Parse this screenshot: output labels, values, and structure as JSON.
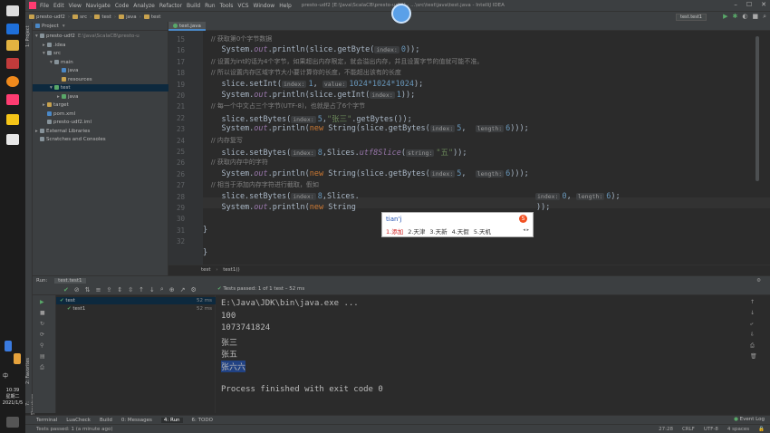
{
  "taskbar": {
    "time": "10:39",
    "weekday": "星期二",
    "date": "2021/1/5",
    "lang": "中"
  },
  "menu": [
    "File",
    "Edit",
    "View",
    "Navigate",
    "Code",
    "Analyze",
    "Refactor",
    "Build",
    "Run",
    "Tools",
    "VCS",
    "Window",
    "Help"
  ],
  "window_title": "presto-udf2 [E:\\Java\\ScalaCB\\presto-udf2] - ...\\src\\test\\java\\test.java - IntelliJ IDEA",
  "breadcrumbs": [
    "presto-udf2",
    "src",
    "test",
    "java",
    "test"
  ],
  "run_config": "test.test1",
  "project": {
    "header": "Project",
    "rows": [
      {
        "indent": 0,
        "arrow": "▾",
        "name": "presto-udf2",
        "extra": "E:\\Java\\ScalaCB\\presto-u",
        "color": "#87939a"
      },
      {
        "indent": 1,
        "arrow": "▸",
        "name": ".idea",
        "extra": "",
        "color": "#87939a"
      },
      {
        "indent": 1,
        "arrow": "▾",
        "name": "src",
        "extra": "",
        "color": "#87939a"
      },
      {
        "indent": 2,
        "arrow": "▾",
        "name": "main",
        "extra": "",
        "color": "#87939a"
      },
      {
        "indent": 3,
        "arrow": "",
        "name": "java",
        "extra": "",
        "color": "#4a88c7"
      },
      {
        "indent": 3,
        "arrow": "",
        "name": "resources",
        "extra": "",
        "color": "#c8a24e"
      },
      {
        "indent": 2,
        "arrow": "▾",
        "name": "test",
        "extra": "",
        "color": "#59a869",
        "selected": true
      },
      {
        "indent": 3,
        "arrow": "▸",
        "name": "java",
        "extra": "",
        "color": "#59a869"
      },
      {
        "indent": 1,
        "arrow": "▸",
        "name": "target",
        "extra": "",
        "color": "#c8a24e"
      },
      {
        "indent": 1,
        "arrow": "",
        "name": "pom.xml",
        "extra": "",
        "color": "#4a88c7"
      },
      {
        "indent": 1,
        "arrow": "",
        "name": "presto-udf2.iml",
        "extra": "",
        "color": "#87939a"
      },
      {
        "indent": 0,
        "arrow": "▸",
        "name": "External Libraries",
        "extra": "",
        "color": "#87939a"
      },
      {
        "indent": 0,
        "arrow": "",
        "name": "Scratches and Consoles",
        "extra": "",
        "color": "#87939a"
      }
    ]
  },
  "editor": {
    "tab": "test.java",
    "lines": [
      {
        "n": "15",
        "segs": [
          {
            "t": "    // 获取第0个字节数据",
            "c": "cm"
          }
        ]
      },
      {
        "n": "16",
        "segs": [
          {
            "t": "    System.",
            "c": ""
          },
          {
            "t": "out",
            "c": "fld"
          },
          {
            "t": ".println(slice.getByte(",
            "c": ""
          },
          {
            "t": "index:",
            "c": "hint"
          },
          {
            "t": "0",
            "c": "num"
          },
          {
            "t": "));",
            "c": ""
          }
        ]
      },
      {
        "n": "17",
        "segs": [
          {
            "t": "    // 设置为int的话为4个字节，如果超出内存限定，就会溢出内存，并且设置字节的值就可能不准。",
            "c": "cm"
          }
        ]
      },
      {
        "n": "18",
        "segs": [
          {
            "t": "    // 所以设置内存区域字节大小要计算你的长度，不能超出该有的长度",
            "c": "cm"
          }
        ]
      },
      {
        "n": "19",
        "segs": [
          {
            "t": "    slice.setInt(",
            "c": ""
          },
          {
            "t": "index:",
            "c": "hint"
          },
          {
            "t": "1",
            "c": "num"
          },
          {
            "t": ", ",
            "c": ""
          },
          {
            "t": "value:",
            "c": "hint"
          },
          {
            "t": "1024*1024*1024",
            "c": "num"
          },
          {
            "t": ");",
            "c": ""
          }
        ]
      },
      {
        "n": "20",
        "segs": [
          {
            "t": "    System.",
            "c": ""
          },
          {
            "t": "out",
            "c": "fld"
          },
          {
            "t": ".println(slice.getInt(",
            "c": ""
          },
          {
            "t": "index:",
            "c": "hint"
          },
          {
            "t": "1",
            "c": "num"
          },
          {
            "t": "));",
            "c": ""
          }
        ]
      },
      {
        "n": "21",
        "segs": [
          {
            "t": "    // 每一个中文占三个字节(UTF-8)，也就是占了6个字节",
            "c": "cm"
          }
        ]
      },
      {
        "n": "22",
        "segs": [
          {
            "t": "    slice.setBytes(",
            "c": ""
          },
          {
            "t": "index:",
            "c": "hint"
          },
          {
            "t": "5",
            "c": "num"
          },
          {
            "t": ",",
            "c": ""
          },
          {
            "t": "\"张三\"",
            "c": "str"
          },
          {
            "t": ".getBytes());",
            "c": ""
          }
        ]
      },
      {
        "n": "23",
        "segs": [
          {
            "t": "    System.",
            "c": ""
          },
          {
            "t": "out",
            "c": "fld"
          },
          {
            "t": ".println(",
            "c": ""
          },
          {
            "t": "new",
            "c": "kw"
          },
          {
            "t": " String(slice.getBytes(",
            "c": ""
          },
          {
            "t": "index:",
            "c": "hint"
          },
          {
            "t": "5",
            "c": "num"
          },
          {
            "t": ",  ",
            "c": ""
          },
          {
            "t": "length:",
            "c": "hint"
          },
          {
            "t": "6",
            "c": "num"
          },
          {
            "t": ")));",
            "c": ""
          }
        ]
      },
      {
        "n": "24",
        "segs": [
          {
            "t": "    // 内存复写",
            "c": "cm"
          }
        ]
      },
      {
        "n": "25",
        "segs": [
          {
            "t": "    slice.setBytes(",
            "c": ""
          },
          {
            "t": "index:",
            "c": "hint"
          },
          {
            "t": "8",
            "c": "num"
          },
          {
            "t": ",Slices.",
            "c": ""
          },
          {
            "t": "utf8Slice",
            "c": "fld"
          },
          {
            "t": "(",
            "c": ""
          },
          {
            "t": "string:",
            "c": "hint"
          },
          {
            "t": "\"五\"",
            "c": "str"
          },
          {
            "t": "));",
            "c": ""
          }
        ]
      },
      {
        "n": "26",
        "segs": [
          {
            "t": "    // 获取内存中的字符",
            "c": "cm"
          }
        ]
      },
      {
        "n": "26",
        "segs": [
          {
            "t": "    System.",
            "c": ""
          },
          {
            "t": "out",
            "c": "fld"
          },
          {
            "t": ".println(",
            "c": ""
          },
          {
            "t": "new",
            "c": "kw"
          },
          {
            "t": " String(slice.getBytes(",
            "c": ""
          },
          {
            "t": "index:",
            "c": "hint"
          },
          {
            "t": "5",
            "c": "num"
          },
          {
            "t": ",  ",
            "c": ""
          },
          {
            "t": "length:",
            "c": "hint"
          },
          {
            "t": "6",
            "c": "num"
          },
          {
            "t": ")));",
            "c": ""
          }
        ]
      },
      {
        "n": "27",
        "segs": [
          {
            "t": "    // 相当于添加内存字符进行截取，假如",
            "c": "cm"
          }
        ]
      },
      {
        "n": "28",
        "segs": [
          {
            "t": "    slice.setBytes(",
            "c": ""
          },
          {
            "t": "index:",
            "c": "hint"
          },
          {
            "t": "8",
            "c": "num"
          },
          {
            "t": ",Slices.",
            "c": ""
          }
        ]
      },
      {
        "n": "29",
        "segs": [
          {
            "t": "    System.",
            "c": ""
          },
          {
            "t": "out",
            "c": "fld"
          },
          {
            "t": ".println(",
            "c": ""
          },
          {
            "t": "new",
            "c": "kw"
          },
          {
            "t": " String",
            "c": ""
          }
        ]
      },
      {
        "n": "30",
        "segs": []
      },
      {
        "n": "31",
        "segs": [
          {
            "t": "}",
            "c": ""
          }
        ]
      },
      {
        "n": "32",
        "segs": []
      },
      {
        "n": "",
        "segs": [
          {
            "t": "}",
            "c": ""
          }
        ]
      }
    ],
    "tail_28": [
      {
        "t": "index:",
        "c": "hint"
      },
      {
        "t": "0",
        "c": "num"
      },
      {
        "t": ", ",
        "c": ""
      },
      {
        "t": "length:",
        "c": "hint"
      },
      {
        "t": "6",
        "c": "num"
      },
      {
        "t": ");",
        "c": ""
      }
    ],
    "tail_29": [
      {
        "t": "));",
        "c": ""
      }
    ],
    "crumbs": [
      "test",
      "test1()"
    ]
  },
  "ime": {
    "input": "tian'j",
    "candidates": [
      "1.添加",
      "2.天津",
      "3.天新",
      "4.天假",
      "5.天机"
    ]
  },
  "run": {
    "header_label": "Run:",
    "config": "test.test1",
    "tests_passed": "Tests passed: 1 of 1 test – 52 ms",
    "tree": [
      {
        "name": "test",
        "time": "52 ms",
        "indent": 0
      },
      {
        "name": "test1",
        "time": "52 ms",
        "indent": 1
      }
    ],
    "output": [
      "E:\\Java\\JDK\\bin\\java.exe ...",
      "100",
      "1073741824",
      "张三",
      "张五",
      "张六六",
      "",
      "Process finished with exit code 0"
    ]
  },
  "tool_tabs": [
    "Terminal",
    "LuaCheck",
    "Build",
    "0: Messages",
    "4: Run",
    "6: TODO"
  ],
  "event_log": "Event Log",
  "status": {
    "left": "Tests passed: 1 (a minute ago)",
    "pos": "27:28",
    "crlf": "CRLF",
    "enc": "UTF-8",
    "indent": "4 spaces"
  }
}
